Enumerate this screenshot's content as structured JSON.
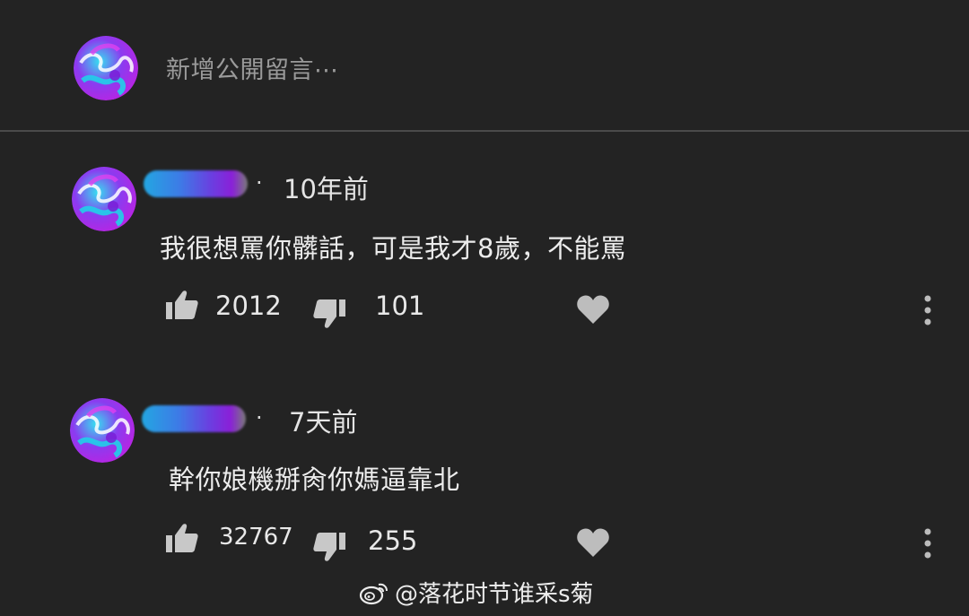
{
  "composer": {
    "placeholder": "新增公開留言⋯"
  },
  "comments": [
    {
      "time": "10年前",
      "text": "我很想罵你髒話，可是我才8歲，不能罵",
      "likes": "2012",
      "dislikes": "101"
    },
    {
      "time": "7天前",
      "text": "幹你娘機掰肏你媽逼靠北",
      "likes": "32767",
      "dislikes": "255"
    }
  ],
  "watermark": {
    "text": "@落花时节谁采s菊",
    "icon": "weibo-icon"
  },
  "colors": {
    "background": "#232323",
    "name_blur_start": "#23a6e2",
    "name_blur_end": "#8a20d8"
  }
}
